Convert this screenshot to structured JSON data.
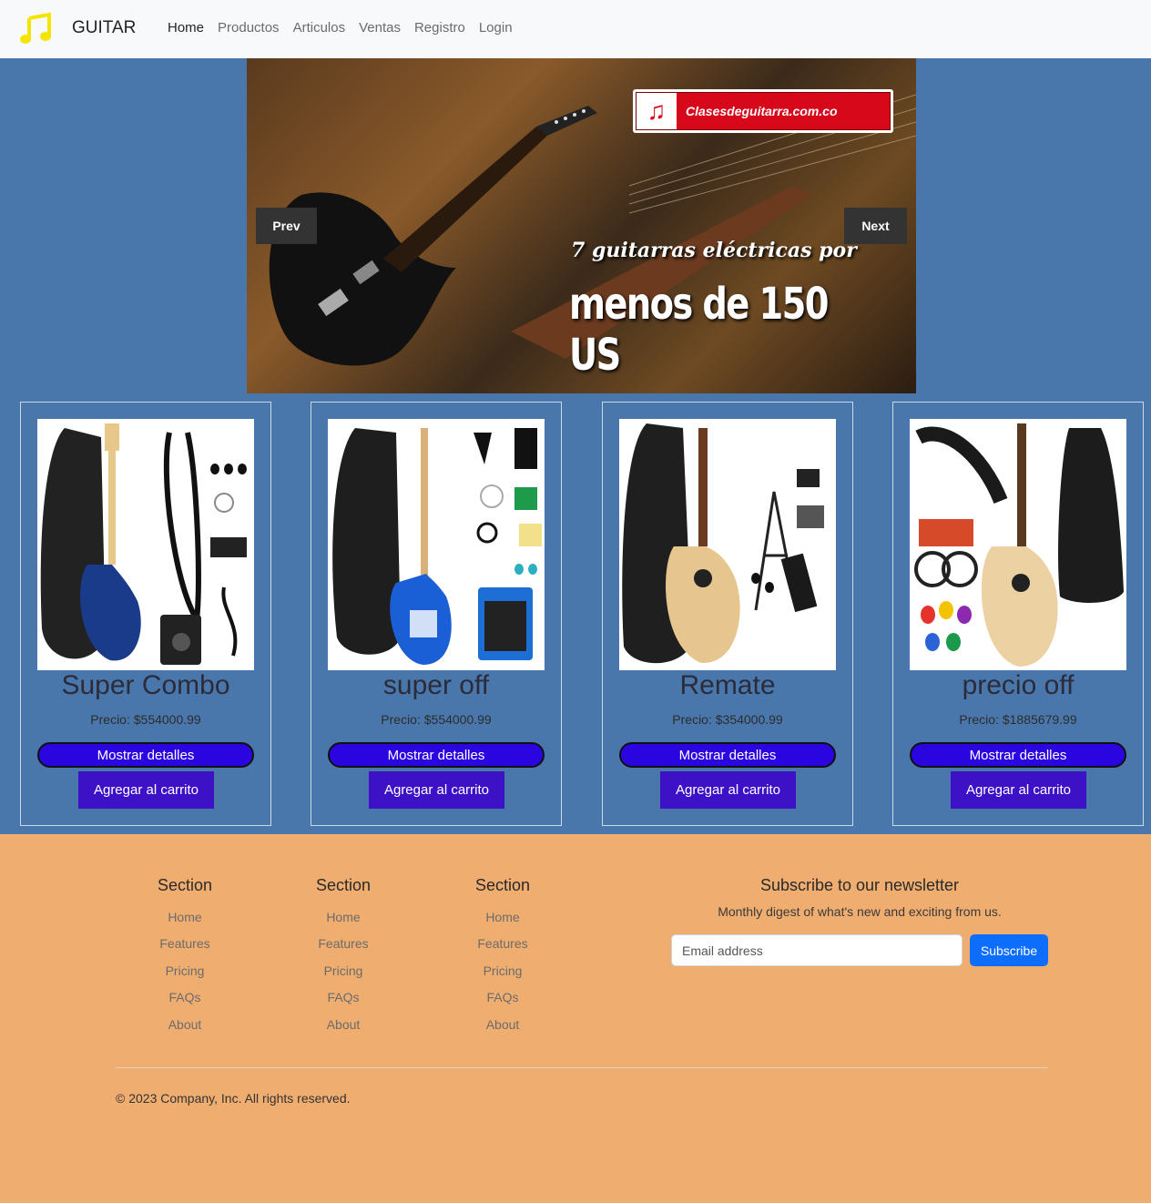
{
  "navbar": {
    "brand": "GUITAR",
    "brand_icon": "music-note-icon",
    "links": [
      "Home",
      "Productos",
      "Articulos",
      "Ventas",
      "Registro",
      "Login"
    ]
  },
  "carousel": {
    "prev": "Prev",
    "next": "Next",
    "badge": "Clasesdeguitarra.com.co",
    "promo_line1": "7 guitarras eléctricas por",
    "promo_line2": "menos de 150 US"
  },
  "products": [
    {
      "title": "Super Combo",
      "price": "Precio: $554000.99",
      "details": "Mostrar detalles",
      "cart": "Agregar al carrito"
    },
    {
      "title": "super off",
      "price": "Precio: $554000.99",
      "details": "Mostrar detalles",
      "cart": "Agregar al carrito"
    },
    {
      "title": "Remate",
      "price": "Precio: $354000.99",
      "details": "Mostrar detalles",
      "cart": "Agregar al carrito"
    },
    {
      "title": "precio off",
      "price": "Precio: $1885679.99",
      "details": "Mostrar detalles",
      "cart": "Agregar al carrito"
    }
  ],
  "footer": {
    "columns": [
      {
        "heading": "Section",
        "links": [
          "Home",
          "Features",
          "Pricing",
          "FAQs",
          "About"
        ]
      },
      {
        "heading": "Section",
        "links": [
          "Home",
          "Features",
          "Pricing",
          "FAQs",
          "About"
        ]
      },
      {
        "heading": "Section",
        "links": [
          "Home",
          "Features",
          "Pricing",
          "FAQs",
          "About"
        ]
      }
    ],
    "newsletter_title": "Subscribe to our newsletter",
    "newsletter_sub": "Monthly digest of what's new and exciting from us.",
    "email_placeholder": "Email address",
    "subscribe": "Subscribe",
    "copyright": "© 2023 Company, Inc. All rights reserved."
  },
  "colors": {
    "navbar_bg": "#f8f9fa",
    "hero_bg": "#4a77ab",
    "footer_bg": "#f0ad70",
    "details_button": "#2a05e0",
    "cart_button": "#3d12c7",
    "subscribe_button": "#0d6efd",
    "logo_yellow": "#f5e400"
  }
}
